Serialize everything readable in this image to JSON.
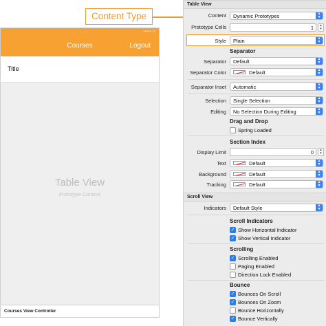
{
  "callout": {
    "label": "Content Type"
  },
  "canvas": {
    "status_text": "••••• ▭",
    "nav_title": "Courses",
    "nav_right": "Logout",
    "cell_title": "Title",
    "table_view_label": "Table View",
    "table_view_sub": "Prototype Content",
    "controller_label": "Courses View Controller"
  },
  "inspector": {
    "table_view_header": "Table View",
    "content_label": "Content",
    "content_value": "Dynamic Prototypes",
    "prototype_cells_label": "Prototype Cells",
    "prototype_cells_value": "1",
    "style_label": "Style",
    "style_value": "Plain",
    "separator_group": "Separator",
    "separator_label": "Separator",
    "separator_value": "Default",
    "separator_color_label": "Separator Color",
    "separator_color_value": "Default",
    "separator_inset_label": "Separator Inset",
    "separator_inset_value": "Automatic",
    "selection_label": "Selection",
    "selection_value": "Single Selection",
    "editing_label": "Editing",
    "editing_value": "No Selection During Editing",
    "drag_drop_group": "Drag and Drop",
    "spring_loaded": "Spring Loaded",
    "section_index_group": "Section Index",
    "display_limit_label": "Display Limit",
    "display_limit_value": "0",
    "text_label": "Text",
    "text_value": "Default",
    "background_label": "Background",
    "background_value": "Default",
    "tracking_label": "Tracking",
    "tracking_value": "Default",
    "scroll_view_header": "Scroll View",
    "indicators_label": "Indicators",
    "indicators_value": "Default Style",
    "scroll_indicators_group": "Scroll Indicators",
    "show_horizontal": "Show Horizontal Indicator",
    "show_vertical": "Show Vertical Indicator",
    "scrolling_group": "Scrolling",
    "scrolling_enabled": "Scrolling Enabled",
    "paging_enabled": "Paging Enabled",
    "direction_lock": "Direction Lock Enabled",
    "bounce_group": "Bounce",
    "bounces_on_scroll": "Bounces On Scroll",
    "bounces_on_zoom": "Bounces On Zoom",
    "bounce_horizontally": "Bounce Horizontally",
    "bounce_vertically": "Bounce Vertically"
  },
  "colors": {
    "accent": "#f7a133",
    "callout": "#f29a2a",
    "checkbox_on": "#2f7de1"
  }
}
